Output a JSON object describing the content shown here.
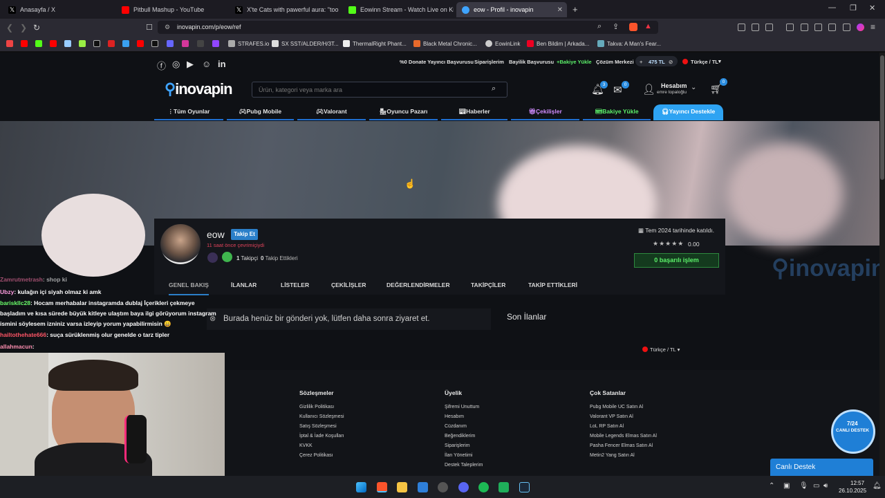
{
  "tabs": [
    {
      "label": "Anasayfa / X"
    },
    {
      "label": "Pitbull Mashup - YouTube"
    },
    {
      "label": "X'te Cats with pawerful aura: \"too mi"
    },
    {
      "label": "Eowinn Stream - Watch Live on Kick"
    },
    {
      "label": "eow - Profil - inovapin"
    }
  ],
  "address": {
    "url": "inovapin.com/p/eow/ref"
  },
  "bookmarks": [
    "STRAFES.io",
    "SX SST/ALDER/H/3T...",
    "ThermalRight Phant...",
    "Black Metal Chronic...",
    "EowinLink",
    "Ben Bildim | Arkada...",
    "Takva: A Man's Fear..."
  ],
  "topbar": {
    "links": [
      "%0 Donate Yayıncı Başvurusu",
      "Siparişlerim",
      "Bayilik Başvurusu",
      "+Bakiye Yükle",
      "Çözüm Merkezi"
    ],
    "balance": "475 TL",
    "language": "Türkçe / TL"
  },
  "header": {
    "logo": "inovapin",
    "search_placeholder": "Ürün, kategori veya marka ara",
    "notif_count": "3",
    "msg_count": "0",
    "cart_count": "0",
    "account_label": "Hesabım",
    "account_user": "emre topaloğlu"
  },
  "nav": [
    "Tüm Oyunlar",
    "Pubg Mobile",
    "Valorant",
    "Oyuncu Pazarı",
    "Haberler",
    "Çekilişler",
    "Bakiye Yükle",
    "Yayıncı Destekle"
  ],
  "profile": {
    "username": "eow",
    "follow_btn": "Takip Et",
    "last_seen": "11 saat önce çevrimiçiydi",
    "followers_count": "1",
    "followers_label": "Takipçi",
    "following_count": "0",
    "following_label": "Takip Ettikleri",
    "joined": "Tem 2024 tarihinde katıldı.",
    "rating": "0.00",
    "success": "0 başarılı işlem"
  },
  "profile_tabs": [
    "GENEL BAKIŞ",
    "İLANLAR",
    "LİSTELER",
    "ÇEKİLİŞLER",
    "DEĞERLENDİRMELER",
    "TAKİPÇİLER",
    "TAKİP ETTİKLERİ"
  ],
  "content": {
    "empty_msg": "Burada henüz bir gönderi yok, lütfen daha sonra ziyaret et.",
    "side_title": "Son İlanlar",
    "lang_select": "Türkçe / TL"
  },
  "watermark": "inovapin",
  "footer": {
    "columns": [
      {
        "title": "Sözleşmeler",
        "links": [
          "Gizlilik Politikası",
          "Kullanıcı Sözleşmesi",
          "Satış Sözleşmesi",
          "İptal & İade Koşulları",
          "KVKK",
          "Çerez Politikası"
        ]
      },
      {
        "title": "Üyelik",
        "links": [
          "Şifremi Unuttum",
          "Hesabım",
          "Cüzdanım",
          "Beğendiklerim",
          "Siparişlerim",
          "İlan Yönetimi",
          "Destek Taleplerim"
        ]
      },
      {
        "title": "Çok Satanlar",
        "links": [
          "Pubg Mobile UC Satın Al",
          "Valorant VP Satın Al",
          "LoL RP Satın Al",
          "Mobile Legends Elmas Satın Al",
          "Pasha Fencer Elmas Satın Al",
          "Metin2 Yang Satın Al"
        ]
      }
    ],
    "support_badge_top": "7/24",
    "support_badge_mid": "CANLI DESTEK",
    "live_support": "Canlı Destek"
  },
  "chat": [
    {
      "user": "Zamrutmetrash",
      "msg": ": shop ki",
      "color": "#ff77aa"
    },
    {
      "user": "Ubzy",
      "msg": ": kulağın içi siyah olmaz ki amk",
      "color": "#ff9de0"
    },
    {
      "user": "bariskllc28",
      "msg": ": Hocam merhabalar instagramda dublaj İçerikleri çekmeye",
      "color": "#6bff6b"
    },
    {
      "user": "",
      "msg": "başladım ve kısa sürede büyük kitleye ulaştım baya ilgi görüyorum instagram",
      "color": "#ffffff"
    },
    {
      "user": "",
      "msg": "ismini söylesem izniniz varsa izleyip yorum yapabilirmisin 😄",
      "color": "#ffffff"
    },
    {
      "user": "hailtothehate666",
      "msg": ": suça sürüklenmiş olur genelde o tarz tipler",
      "color": "#ff5566"
    },
    {
      "user": "allahmacun",
      "msg": ":",
      "color": "#ff8fb1"
    }
  ],
  "taskbar": {
    "time": "12:57",
    "date": "26.10.2025"
  }
}
